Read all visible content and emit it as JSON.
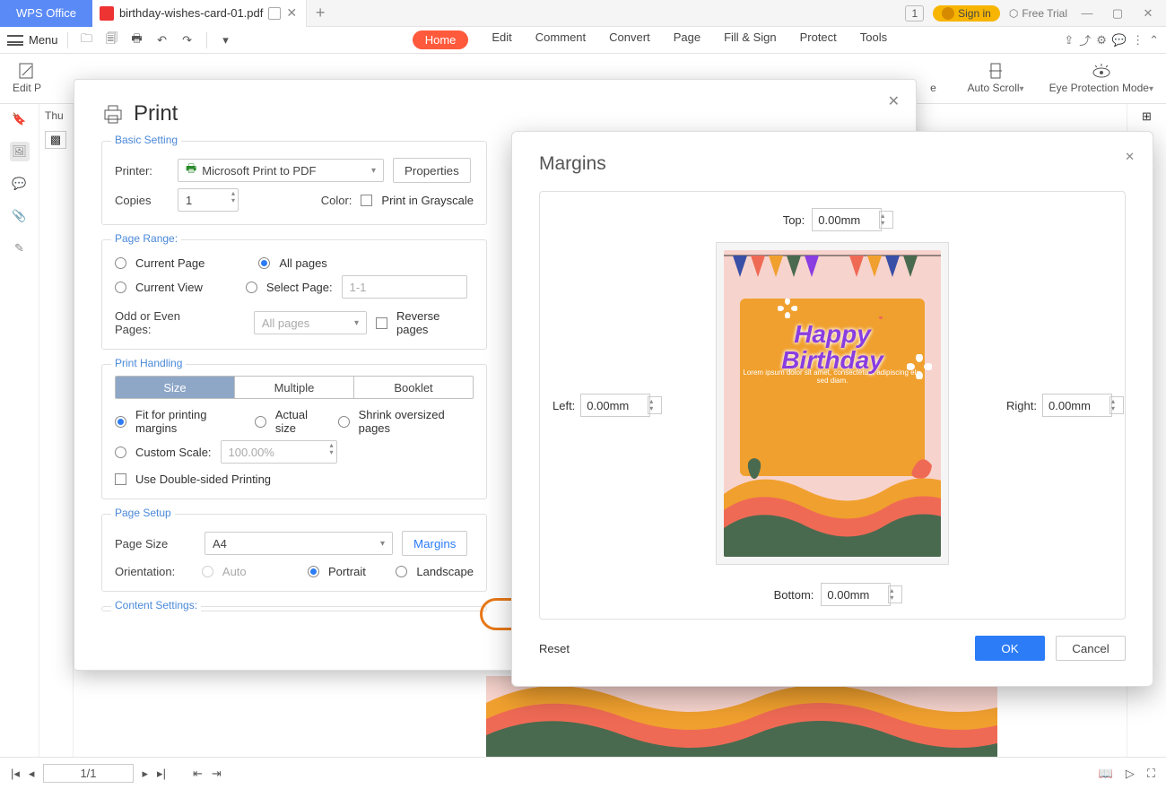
{
  "titlebar": {
    "app": "WPS Office",
    "tab_file": "birthday-wishes-card-01.pdf",
    "tab_count": "1",
    "sign_in": "Sign in",
    "free_trial": "Free Trial"
  },
  "menubar": {
    "menu": "Menu",
    "items": [
      "Home",
      "Edit",
      "Comment",
      "Convert",
      "Page",
      "Fill & Sign",
      "Protect",
      "Tools"
    ]
  },
  "ribbon": {
    "edit_peek": "Edit P",
    "right1": "e",
    "autoscroll": "Auto Scroll",
    "eye": "Eye Protection Mode"
  },
  "thumbs_label": "Thu",
  "print": {
    "title": "Print",
    "basic": {
      "legend": "Basic Setting",
      "printer": "Printer:",
      "printer_value": "Microsoft Print to PDF",
      "properties": "Properties",
      "copies": "Copies",
      "copies_value": "1",
      "color": "Color:",
      "grayscale": "Print in Grayscale"
    },
    "range": {
      "legend": "Page Range:",
      "current_page": "Current Page",
      "all_pages": "All pages",
      "current_view": "Current View",
      "select_page": "Select Page:",
      "select_value": "1-1",
      "odd_even": "Odd or Even Pages:",
      "odd_even_value": "All pages",
      "reverse": "Reverse pages"
    },
    "handling": {
      "legend": "Print Handling",
      "seg": [
        "Size",
        "Multiple",
        "Booklet"
      ],
      "fit": "Fit for printing margins",
      "actual": "Actual size",
      "shrink": "Shrink oversized pages",
      "custom": "Custom Scale:",
      "custom_value": "100.00%",
      "double": "Use Double-sided Printing"
    },
    "setup": {
      "legend": "Page Setup",
      "page_size": "Page Size",
      "page_size_value": "A4",
      "margins": "Margins",
      "orientation": "Orientation:",
      "auto": "Auto",
      "portrait": "Portrait",
      "landscape": "Landscape"
    },
    "content_legend": "Content Settings:"
  },
  "margins": {
    "title": "Margins",
    "top": "Top:",
    "bottom": "Bottom:",
    "left": "Left:",
    "right": "Right:",
    "value": "0.00mm",
    "reset": "Reset",
    "ok": "OK",
    "cancel": "Cancel",
    "card_title_1": "Happy",
    "card_title_2": "Birthday",
    "lorem": "Lorem ipsum dolor sit amet, consectetuer adipiscing elit, sed diam."
  },
  "status": {
    "page": "1/1"
  }
}
